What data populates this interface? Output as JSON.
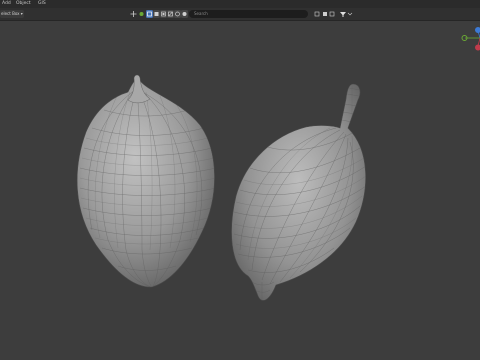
{
  "menubar": {
    "items": [
      "Add",
      "Object",
      "GIS"
    ]
  },
  "header": {
    "select_box_label": "elect Box ▾",
    "transform_label": "Global",
    "search_placeholder": "Search"
  },
  "icons": {
    "tools": [
      "move-tool-icon",
      "select-box-icon",
      "select-circle-icon",
      "select-lasso-icon",
      "transform-icon",
      "cursor-icon",
      "annotate-icon"
    ],
    "right": [
      "filter-icon",
      "view-icon",
      "funnel-icon"
    ]
  },
  "colors": {
    "background": "#3d3d3d",
    "header": "#303030",
    "menubar": "#2b2b2b",
    "accent": "#4772b3",
    "gizmo_x": "#c13b4b",
    "gizmo_y": "#6aa834",
    "gizmo_z": "#3c7ad6",
    "mesh": "#9a9a9a"
  }
}
